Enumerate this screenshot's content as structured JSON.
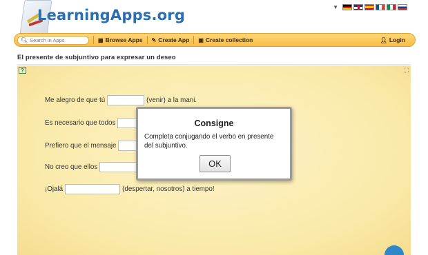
{
  "header": {
    "logo_text": "LearningApps.org",
    "languages": [
      "de",
      "gb",
      "es",
      "fr",
      "it",
      "ru"
    ]
  },
  "toolbar": {
    "search_placeholder": "Search in Apps",
    "browse_label": "Browse Apps",
    "create_label": "Create App",
    "collection_label": "Create collection",
    "login_label": "Login"
  },
  "app": {
    "title": "El presente de subjuntivo para expresar un deseo",
    "sentences": [
      {
        "before": "Me alegro de que tú",
        "after": "(venir) a la mani."
      },
      {
        "before": "Es necesario que todos",
        "after": ""
      },
      {
        "before": "Prefiero que el mensaje",
        "after": ""
      },
      {
        "before": "No creo que ellos",
        "after": ""
      },
      {
        "before": "¡Ojalá",
        "after": "(despertar, nosotros) a tiempo!"
      }
    ]
  },
  "dialog": {
    "title": "Consigne",
    "body": "Completa conjugando el verbo en presente del subjuntivo.",
    "ok_label": "OK"
  },
  "colors": {
    "toolbar": "#f6bd43",
    "app_bg": "#fae9a8",
    "logo_text": "#2a6fb2",
    "scroll_button": "#2f86c8"
  }
}
